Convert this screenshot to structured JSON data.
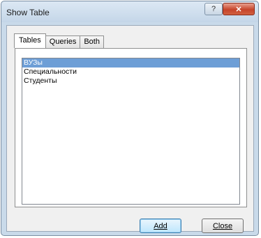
{
  "window": {
    "title": "Show Table",
    "help_glyph": "?",
    "close_glyph": "✕"
  },
  "tabs": [
    {
      "label": "Tables",
      "active": true
    },
    {
      "label": "Queries",
      "active": false
    },
    {
      "label": "Both",
      "active": false
    }
  ],
  "list": {
    "items": [
      {
        "label": "ВУЗы",
        "selected": true
      },
      {
        "label": "Специальности",
        "selected": false
      },
      {
        "label": "Студенты",
        "selected": false
      }
    ]
  },
  "buttons": {
    "add_label": "Add",
    "close_label": "Close"
  },
  "colors": {
    "selection": "#6d9ed6",
    "close_button": "#c6442a",
    "frame": "#c9daea"
  }
}
